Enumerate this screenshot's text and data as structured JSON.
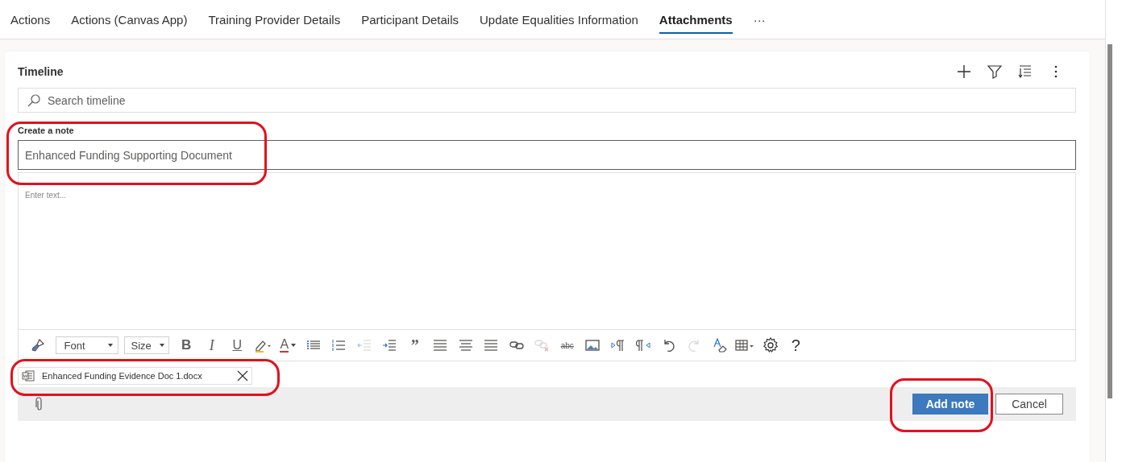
{
  "tabs": [
    {
      "label": "Actions",
      "selected": false
    },
    {
      "label": "Actions (Canvas App)",
      "selected": false
    },
    {
      "label": "Training Provider Details",
      "selected": false
    },
    {
      "label": "Participant Details",
      "selected": false
    },
    {
      "label": "Update Equalities Information",
      "selected": false
    },
    {
      "label": "Attachments",
      "selected": true
    },
    {
      "label": "···",
      "selected": false
    }
  ],
  "timeline": {
    "title": "Timeline",
    "header_actions": [
      {
        "kind": "add"
      },
      {
        "kind": "filter"
      },
      {
        "kind": "sort"
      },
      {
        "kind": "more"
      }
    ],
    "search": {
      "placeholder": "Search timeline"
    },
    "note": {
      "label": "Create a note",
      "title_value": "Enhanced Funding Supporting Document",
      "body_placeholder": "Enter text...",
      "toolbar": [
        {
          "kind": "brush",
          "disabled": false
        },
        {
          "kind": "dropdown",
          "label": "Font",
          "disabled": false
        },
        {
          "kind": "dropdown",
          "label": "Size",
          "disabled": false
        },
        {
          "kind": "bold",
          "label": "B",
          "disabled": false
        },
        {
          "kind": "italic",
          "label": "I",
          "disabled": false
        },
        {
          "kind": "underline",
          "label": "U",
          "disabled": false
        },
        {
          "kind": "highlight",
          "disabled": false
        },
        {
          "kind": "font-color",
          "label": "A",
          "disabled": false
        },
        {
          "kind": "bullets",
          "disabled": false
        },
        {
          "kind": "numbering",
          "disabled": false
        },
        {
          "kind": "outdent",
          "disabled": true
        },
        {
          "kind": "indent",
          "disabled": false
        },
        {
          "kind": "quote",
          "label": "”",
          "disabled": false
        },
        {
          "kind": "align-left",
          "disabled": false
        },
        {
          "kind": "align-center",
          "disabled": false
        },
        {
          "kind": "align-right",
          "disabled": false
        },
        {
          "kind": "link",
          "disabled": false
        },
        {
          "kind": "unlink",
          "disabled": true
        },
        {
          "kind": "strike",
          "label": "abc",
          "disabled": false
        },
        {
          "kind": "image",
          "disabled": false
        },
        {
          "kind": "ltr",
          "disabled": false
        },
        {
          "kind": "rtl",
          "disabled": false
        },
        {
          "kind": "undo",
          "disabled": false
        },
        {
          "kind": "redo",
          "disabled": true
        },
        {
          "kind": "clear-format",
          "disabled": false
        },
        {
          "kind": "table",
          "disabled": false
        },
        {
          "kind": "settings",
          "disabled": false
        },
        {
          "kind": "help",
          "label": "?",
          "disabled": false
        }
      ],
      "attachments": [
        {
          "name": "Enhanced Funding Evidence Doc 1.docx"
        }
      ],
      "buttons": [
        {
          "label": "Add note",
          "kind": "primary"
        },
        {
          "label": "Cancel",
          "kind": "secondary"
        }
      ]
    }
  },
  "annotations": [
    {
      "kind": "outline"
    },
    {
      "kind": "outline"
    },
    {
      "kind": "outline"
    }
  ]
}
